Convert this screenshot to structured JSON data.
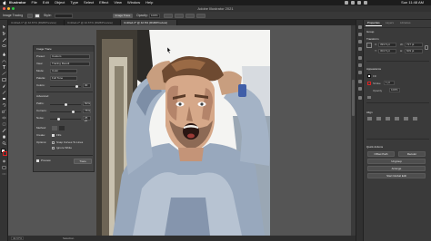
{
  "menubar": {
    "items": [
      "Illustrator",
      "File",
      "Edit",
      "Object",
      "Type",
      "Select",
      "Effect",
      "View",
      "Window",
      "Help"
    ],
    "clock": "Sun 11:48 AM"
  },
  "titlebar": {
    "title": "Adobe Illustrator 2021"
  },
  "controlbar": {
    "selection": "Image Tracing",
    "opacity_label": "Opacity:",
    "opacity_value": "100%",
    "style_label": "Style:",
    "preset_label": "Preset:",
    "preset_value": "Custom",
    "view_label": "View:",
    "view_value": "Tracing Result",
    "expand_button": "Expand",
    "trace_button": "Image Trace",
    "mask_button": "Mask"
  },
  "tabs": [
    {
      "label": "Untitled-1* @ 42.67% (RGB/Preview)"
    },
    {
      "label": "Untitled-2* @ 42.67% (RGB/Preview)"
    },
    {
      "label": "Untitled-3* @ 42.6% (RGB/Preview)"
    }
  ],
  "image_trace_panel": {
    "title": "Image Trace",
    "preset_label": "Preset:",
    "preset_value": "Custom",
    "view_label": "View:",
    "view_value": "Tracing Result",
    "mode_label": "Mode:",
    "mode_value": "Color",
    "palette_label": "Palette:",
    "palette_value": "Full Tone",
    "colors_label": "Colors:",
    "colors_value": "30",
    "advanced_label": "Advanced",
    "paths_label": "Paths:",
    "paths_value": "50%",
    "corners_label": "Corners:",
    "corners_value": "75%",
    "noise_label": "Noise:",
    "noise_value": "25 px",
    "method_label": "Method:",
    "create_label": "Create:",
    "fills_label": "Fills",
    "options_label": "Options:",
    "snap_label": "Snap Curves To Lines",
    "ignore_label": "Ignore White",
    "preview_label": "Preview",
    "trace_button": "Trace"
  },
  "properties": {
    "tabs": [
      "Properties",
      "Layers",
      "Libraries"
    ],
    "header": "Group",
    "transform_label": "Transform",
    "x_label": "X:",
    "x_value": "393.5 pt",
    "y_label": "Y:",
    "y_value": "304.5 pt",
    "w_label": "W:",
    "w_value": "727 pt",
    "h_label": "H:",
    "h_value": "609 pt",
    "appearance_label": "Appearance",
    "fill_label": "Fill",
    "stroke_label": "Stroke",
    "stroke_value": "1 pt",
    "opacity_label": "Opacity",
    "opacity_value": "100%",
    "align_label": "Align",
    "quick_actions_label": "Quick Actions",
    "ungroup_button": "Ungroup",
    "recolor_button": "Recolor",
    "arrange_button": "Arrange",
    "start_global_edit_button": "Start Global Edit",
    "offset_path_button": "Offset Path"
  },
  "statusbar": {
    "zoom": "42.67%",
    "tool": "Selection"
  }
}
